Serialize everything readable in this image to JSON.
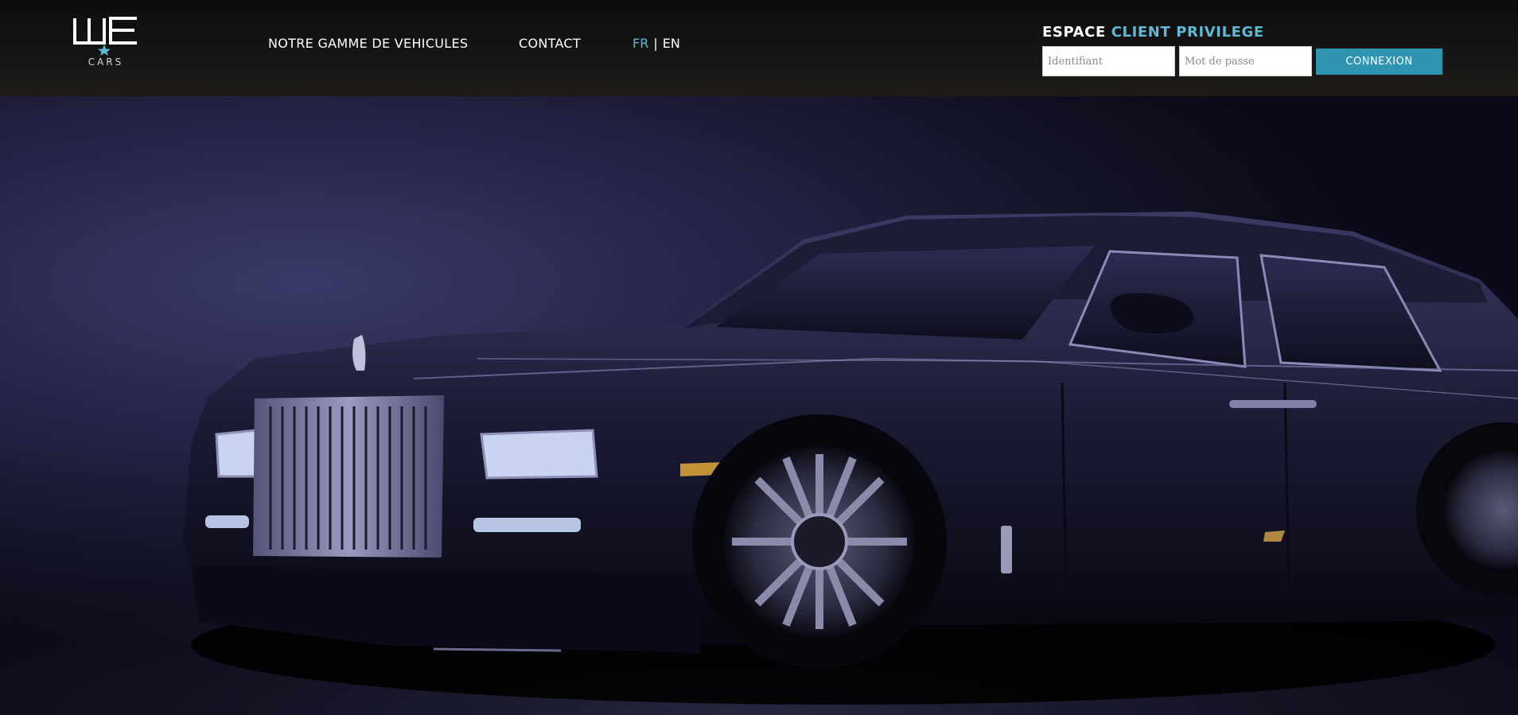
{
  "header": {
    "logo": {
      "mark": "WE",
      "sub": "CARS",
      "icon": "star-icon"
    },
    "nav": {
      "gamme_label": "NOTRE GAMME DE VEHICULES",
      "contact_label": "CONTACT"
    },
    "lang": {
      "fr": "FR",
      "separator": "|",
      "en": "EN",
      "active": "FR"
    },
    "client": {
      "title_part1": "ESPACE",
      "title_part2": "CLIENT PRIVILEGE",
      "id_placeholder": "Identifiant",
      "password_placeholder": "Mot de passe",
      "login_label": "CONNEXION"
    }
  },
  "colors": {
    "accent": "#5fb8d4",
    "button": "#2f94b0",
    "header_bg": "#141210",
    "hero_bg": "#25254a"
  },
  "hero": {
    "image": "luxury-car-photo"
  }
}
